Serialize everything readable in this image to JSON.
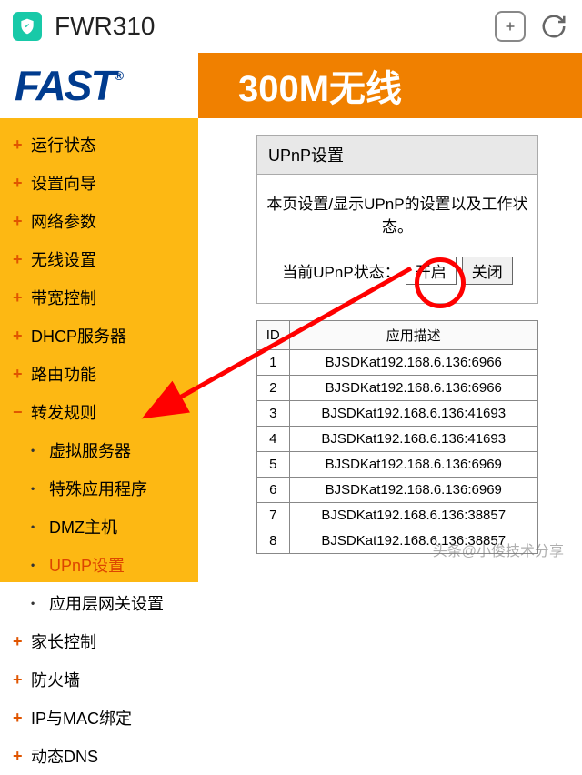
{
  "browser": {
    "address": "FWR310"
  },
  "header": {
    "logo": "FAST",
    "banner": "300M无线"
  },
  "sidebar": {
    "items": [
      {
        "label": "运行状态",
        "type": "top"
      },
      {
        "label": "设置向导",
        "type": "top"
      },
      {
        "label": "网络参数",
        "type": "top"
      },
      {
        "label": "无线设置",
        "type": "top"
      },
      {
        "label": "带宽控制",
        "type": "top"
      },
      {
        "label": "DHCP服务器",
        "type": "top"
      },
      {
        "label": "路由功能",
        "type": "top"
      },
      {
        "label": "转发规则",
        "type": "expanded"
      },
      {
        "label": "虚拟服务器",
        "type": "sub"
      },
      {
        "label": "特殊应用程序",
        "type": "sub"
      },
      {
        "label": "DMZ主机",
        "type": "sub"
      },
      {
        "label": "UPnP设置",
        "type": "sub-active"
      },
      {
        "label": "应用层网关设置",
        "type": "sub"
      },
      {
        "label": "家长控制",
        "type": "top"
      },
      {
        "label": "防火墙",
        "type": "top"
      },
      {
        "label": "IP与MAC绑定",
        "type": "top"
      },
      {
        "label": "动态DNS",
        "type": "top"
      }
    ]
  },
  "panel": {
    "title": "UPnP设置",
    "desc": "本页设置/显示UPnP的设置以及工作状态。",
    "status_label": "当前UPnP状态：",
    "btn_on": "开启",
    "btn_off": "关闭"
  },
  "table": {
    "col_id": "ID",
    "col_desc": "应用描述",
    "rows": [
      {
        "id": "1",
        "desc": "BJSDKat192.168.6.136:6966"
      },
      {
        "id": "2",
        "desc": "BJSDKat192.168.6.136:6966"
      },
      {
        "id": "3",
        "desc": "BJSDKat192.168.6.136:41693"
      },
      {
        "id": "4",
        "desc": "BJSDKat192.168.6.136:41693"
      },
      {
        "id": "5",
        "desc": "BJSDKat192.168.6.136:6969"
      },
      {
        "id": "6",
        "desc": "BJSDKat192.168.6.136:6969"
      },
      {
        "id": "7",
        "desc": "BJSDKat192.168.6.136:38857"
      },
      {
        "id": "8",
        "desc": "BJSDKat192.168.6.136:38857"
      }
    ]
  },
  "watermark": "头条@小俊技术分享"
}
